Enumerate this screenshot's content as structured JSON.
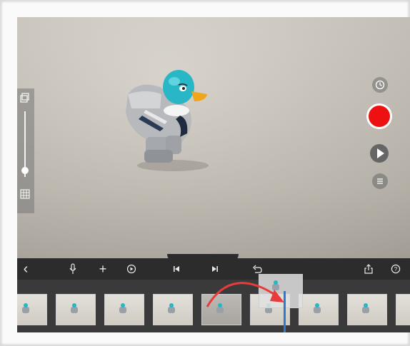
{
  "toolbar": {
    "back": "‹",
    "mic": "🎙",
    "add": "+",
    "play_circle": "▶",
    "prev_frame": "⏮",
    "next_frame": "⏭",
    "undo": "↺",
    "share": "⇪",
    "help": "?"
  },
  "left_panel": {
    "top_icon": "camera-layers-icon",
    "bottom_icon": "grid-icon",
    "level": 0.9
  },
  "right_controls": {
    "timer_icon": "timer-icon",
    "record_icon": "record-icon",
    "play_icon": "play-icon",
    "menu_icon": "menu-icon",
    "record_color": "#ee1111"
  },
  "filmstrip": {
    "frame_count": 10,
    "selected_frame_index": 5,
    "playhead_color": "#2a7bd4",
    "arrow_color": "#e83b3b"
  }
}
